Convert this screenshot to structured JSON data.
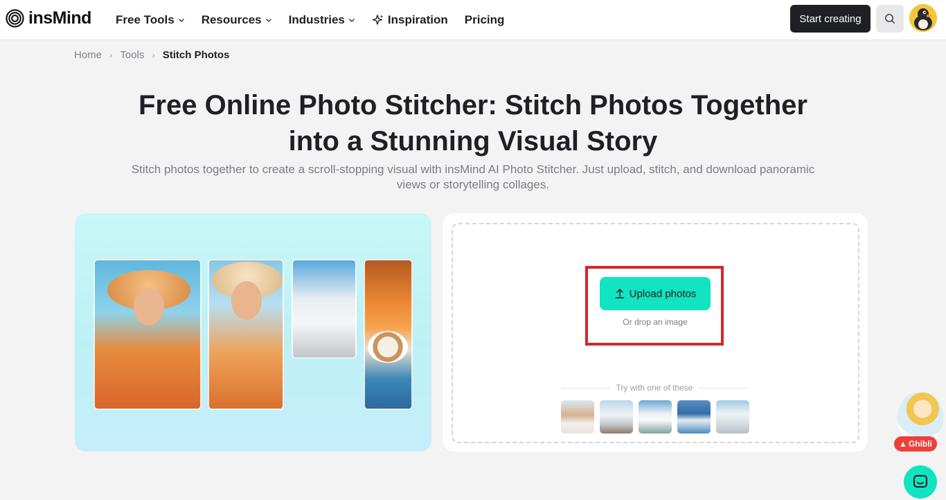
{
  "header": {
    "logo_text": "insMind",
    "nav": [
      {
        "label": "Free Tools",
        "has_dropdown": true
      },
      {
        "label": "Resources",
        "has_dropdown": true
      },
      {
        "label": "Industries",
        "has_dropdown": true
      },
      {
        "label": "Inspiration",
        "icon": "sparkle-icon"
      },
      {
        "label": "Pricing"
      }
    ],
    "start_label": "Start creating"
  },
  "breadcrumb": {
    "home": "Home",
    "tools": "Tools",
    "current": "Stitch Photos"
  },
  "hero": {
    "title": "Free Online Photo Stitcher: Stitch Photos Together into a Stunning Visual Story",
    "subtitle": "Stitch photos together to create a scroll-stopping visual with insMind AI Photo Stitcher. Just upload, stitch, and download panoramic views or storytelling collages."
  },
  "upload": {
    "button_label": "Upload photos",
    "hint": "Or drop an image",
    "try_label": "Try with one of these",
    "accent_color": "#12e3c1",
    "highlight_color": "#d6262b"
  },
  "floating": {
    "ghibli_label": "Ghibli"
  }
}
